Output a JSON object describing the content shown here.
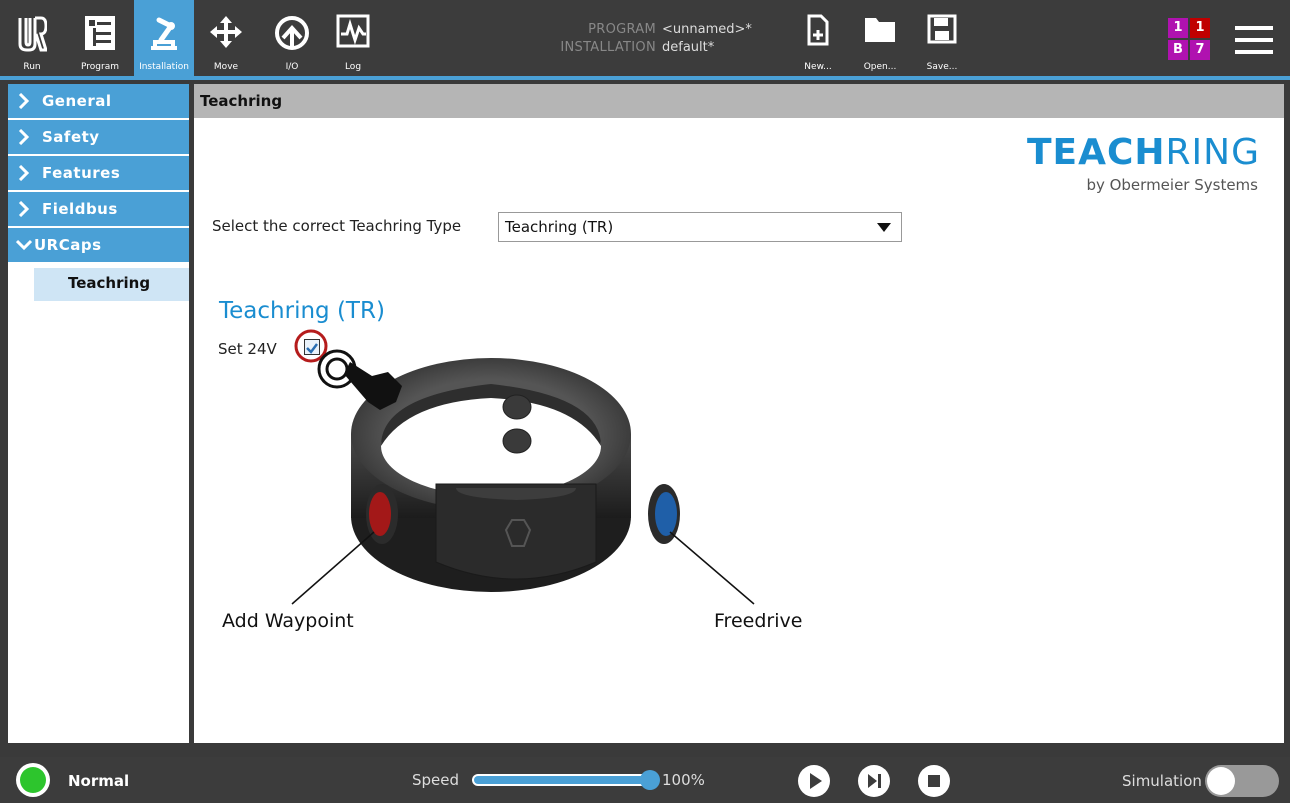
{
  "toolbar": {
    "run": "Run",
    "program": "Program",
    "installation": "Installation",
    "move": "Move",
    "io": "I/O",
    "log": "Log",
    "new": "New...",
    "open": "Open...",
    "save": "Save..."
  },
  "program_info": {
    "program_key": "PROGRAM",
    "program_value": "<unnamed>*",
    "installation_key": "INSTALLATION",
    "installation_value": "default*"
  },
  "badges": [
    "1",
    "1",
    "B",
    "7"
  ],
  "badge_colors": [
    "#b012b0",
    "#c00000",
    "#b012b0",
    "#b012b0"
  ],
  "sidebar": {
    "items": [
      {
        "label": "General",
        "expanded": false
      },
      {
        "label": "Safety",
        "expanded": false
      },
      {
        "label": "Features",
        "expanded": false
      },
      {
        "label": "Fieldbus",
        "expanded": false
      },
      {
        "label": "URCaps",
        "expanded": true
      }
    ],
    "subitem": "Teachring"
  },
  "content": {
    "header": "Teachring",
    "logo_bold": "TEACH",
    "logo_light": "RING",
    "logo_sub": "by Obermeier Systems",
    "select_label": "Select the correct Teachring Type",
    "select_value": "Teachring (TR)",
    "title": "Teachring (TR)",
    "set24v_label": "Set 24V",
    "set24v_checked": true,
    "caption_left": "Add Waypoint",
    "caption_right": "Freedrive"
  },
  "statusbar": {
    "status": "Normal",
    "speed_label": "Speed",
    "speed_value": "100%",
    "speed_fraction": 1.0,
    "simulation_label": "Simulation",
    "simulation_on": false
  },
  "colors": {
    "accent": "#4aa0d6",
    "status_ok": "#2dc52d",
    "logo": "#1a8dd0"
  }
}
